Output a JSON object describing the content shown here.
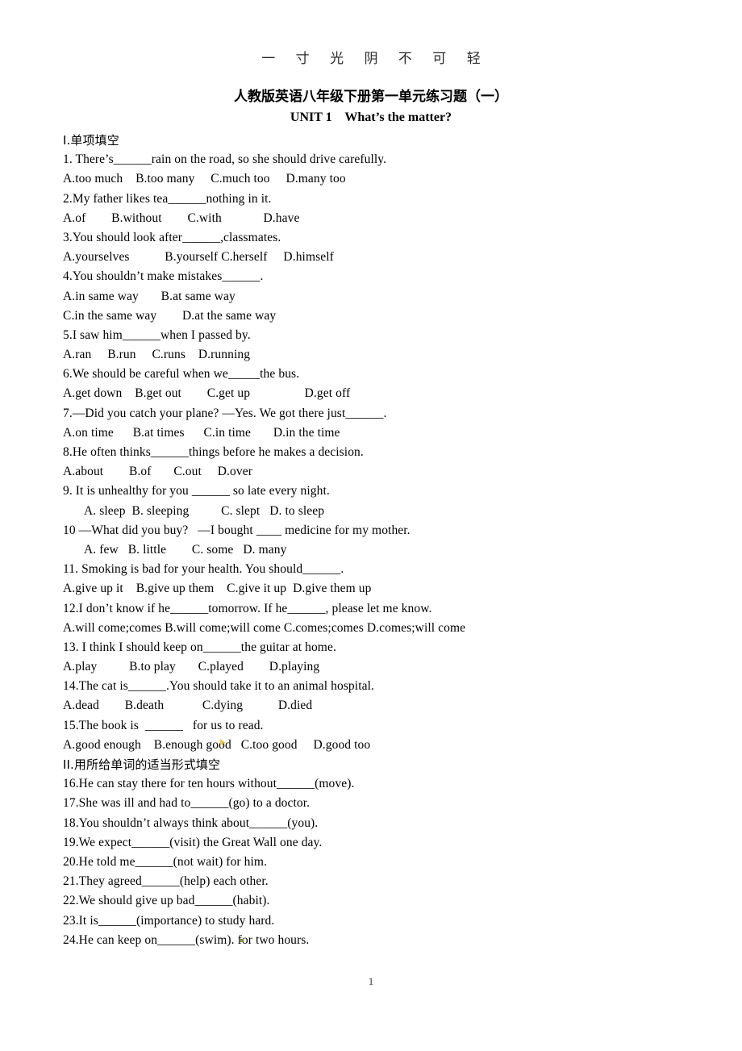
{
  "page": {
    "running_header": "一 寸 光 阴 不 可 轻",
    "title": "人教版英语八年级下册第一单元练习题（一）",
    "subtitle": "UNIT 1    What’s the matter?",
    "page_number": "1",
    "background_color": "#ffffff",
    "text_color": "#000000"
  },
  "sections": [
    {
      "heading": "I.单项填空",
      "lines": [
        {
          "text": "1. There’s______rain on the road, so she should drive carefully.",
          "indent": false
        },
        {
          "text": "A.too much    B.too many     C.much too     D.many too",
          "indent": false
        },
        {
          "text": "2.My father likes tea______nothing in it.",
          "indent": false
        },
        {
          "text": "A.of        B.without        C.with             D.have",
          "indent": false
        },
        {
          "text": "3.You should look after______,classmates.",
          "indent": false
        },
        {
          "text": "A.yourselves           B.yourself C.herself     D.himself",
          "indent": false
        },
        {
          "text": "4.You shouldn’t make mistakes______.",
          "indent": false
        },
        {
          "text": "A.in same way       B.at same way",
          "indent": false
        },
        {
          "text": "C.in the same way        D.at the same way",
          "indent": false
        },
        {
          "text": "5.I saw him______when I passed by.",
          "indent": false
        },
        {
          "text": "A.ran     B.run     C.runs    D.running",
          "indent": false
        },
        {
          "text": "6.We should be careful when we_____the bus.",
          "indent": false
        },
        {
          "text": "A.get down    B.get out        C.get up                 D.get off",
          "indent": false
        },
        {
          "text": "7.—Did you catch your plane? —Yes. We got there just______.",
          "indent": false
        },
        {
          "text": "A.on time      B.at times      C.in time       D.in the time",
          "indent": false
        },
        {
          "text": "8.He often thinks______things before he makes a decision.",
          "indent": false
        },
        {
          "text": "A.about        B.of       C.out     D.over",
          "indent": false
        },
        {
          "text": "9. It is unhealthy for you ______ so late every night.",
          "indent": false
        },
        {
          "text": "A. sleep  B. sleeping          C. slept   D. to sleep",
          "indent": true
        },
        {
          "text": "10 —What did you buy?   —I bought ____ medicine for my mother.",
          "indent": false
        },
        {
          "text": "A. few   B. little        C. some   D. many",
          "indent": true
        },
        {
          "text": "11. Smoking is bad for your health. You should______.",
          "indent": false
        },
        {
          "text": "A.give up it    B.give up them    C.give it up  D.give them up",
          "indent": false
        },
        {
          "text": "12.I don’t know if he______tomorrow. If he______, please let me know.",
          "indent": false
        },
        {
          "text": "A.will come;comes B.will come;will come C.comes;comes D.comes;will come",
          "indent": false
        },
        {
          "text": "13. I think I should keep on______the guitar at home.",
          "indent": false
        },
        {
          "text": "A.play          B.to play       C.played        D.playing",
          "indent": false
        },
        {
          "text": "14.The cat is______.You should take it to an animal hospital.",
          "indent": false
        },
        {
          "text": "A.dead        B.death            C.dying           D.died",
          "indent": false
        },
        {
          "text": "15.The book is  ______   for us to read.",
          "indent": false
        },
        {
          "text": "A.good enough    B.enough good   C.too good     D.good too",
          "indent": false
        }
      ]
    },
    {
      "heading": "II.用所给单词的适当形式填空",
      "lines": [
        {
          "text": "16.He can stay there for ten hours without______(move).",
          "indent": false
        },
        {
          "text": "17.She was ill and had to______(go) to a doctor.",
          "indent": false
        },
        {
          "text": "18.You shouldn’t always think about______(you).",
          "indent": false
        },
        {
          "text": "19.We expect______(visit) the Great Wall one day.",
          "indent": false
        },
        {
          "text": "20.He told me______(not wait) for him.",
          "indent": false
        },
        {
          "text": "21.They agreed______(help) each other.",
          "indent": false
        },
        {
          "text": "22.We should give up bad______(habit).",
          "indent": false
        },
        {
          "text": "23.It is______(importance) to study hard.",
          "indent": false
        },
        {
          "text": "24.He can keep on______(swim). for two hours.",
          "indent": false
        }
      ]
    }
  ]
}
